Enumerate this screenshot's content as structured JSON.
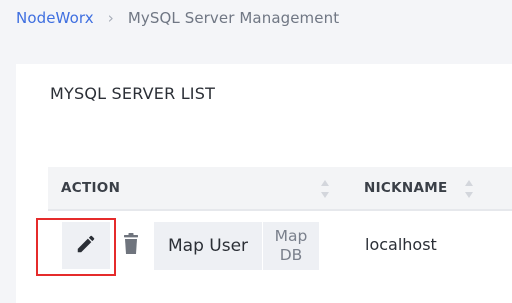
{
  "breadcrumb": {
    "root": "NodeWorx",
    "separator": "›",
    "current": "MySQL Server Management"
  },
  "card": {
    "title": "MYSQL SERVER LIST"
  },
  "table": {
    "columns": [
      "ACTION",
      "NICKNAME"
    ],
    "rows": [
      {
        "actions": {
          "edit_icon": "pencil-icon",
          "delete_icon": "trash-icon",
          "map_user": "Map User",
          "map_db_line1": "Map",
          "map_db_line2": "DB"
        },
        "nickname": "localhost"
      }
    ]
  },
  "colors": {
    "link": "#3f6fe0",
    "highlight": "#e52b2b",
    "button_bg": "#eef0f4",
    "page_bg": "#f4f5f8"
  }
}
